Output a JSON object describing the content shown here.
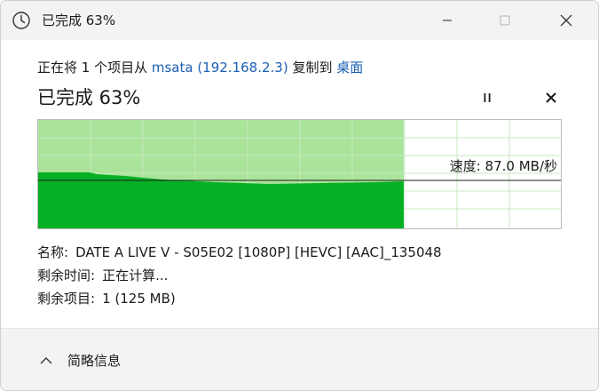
{
  "window": {
    "title": "已完成 63%"
  },
  "transfer": {
    "desc_prefix": "正在将 1 个项目从 ",
    "source": "msata (192.168.2.3)",
    "desc_middle": " 复制到 ",
    "destination": "桌面",
    "progress_title": "已完成 63%",
    "progress_fraction": 0.63,
    "speed_label": "速度: 87.0 MB/秒"
  },
  "details": {
    "name_label": "名称:",
    "name_value": "DATE A LIVE V - S05E02 [1080P] [HEVC] [AAC]_135048",
    "time_label": "剩余时间:",
    "time_value": "正在计算...",
    "items_label": "剩余项目:",
    "items_value": "1 (125 MB)"
  },
  "footer": {
    "collapse_label": "简略信息"
  },
  "colors": {
    "fill_dark": "#06b025",
    "fill_light": "#a9e49a",
    "grid": "#c9e9c0",
    "link": "#1a5fb4"
  },
  "icons": {
    "title": "clock-icon",
    "minimize": "minimize-icon",
    "maximize": "maximize-icon",
    "close": "close-icon",
    "pause": "pause-icon",
    "cancel": "cancel-icon",
    "collapse": "chevron-up-icon"
  }
}
